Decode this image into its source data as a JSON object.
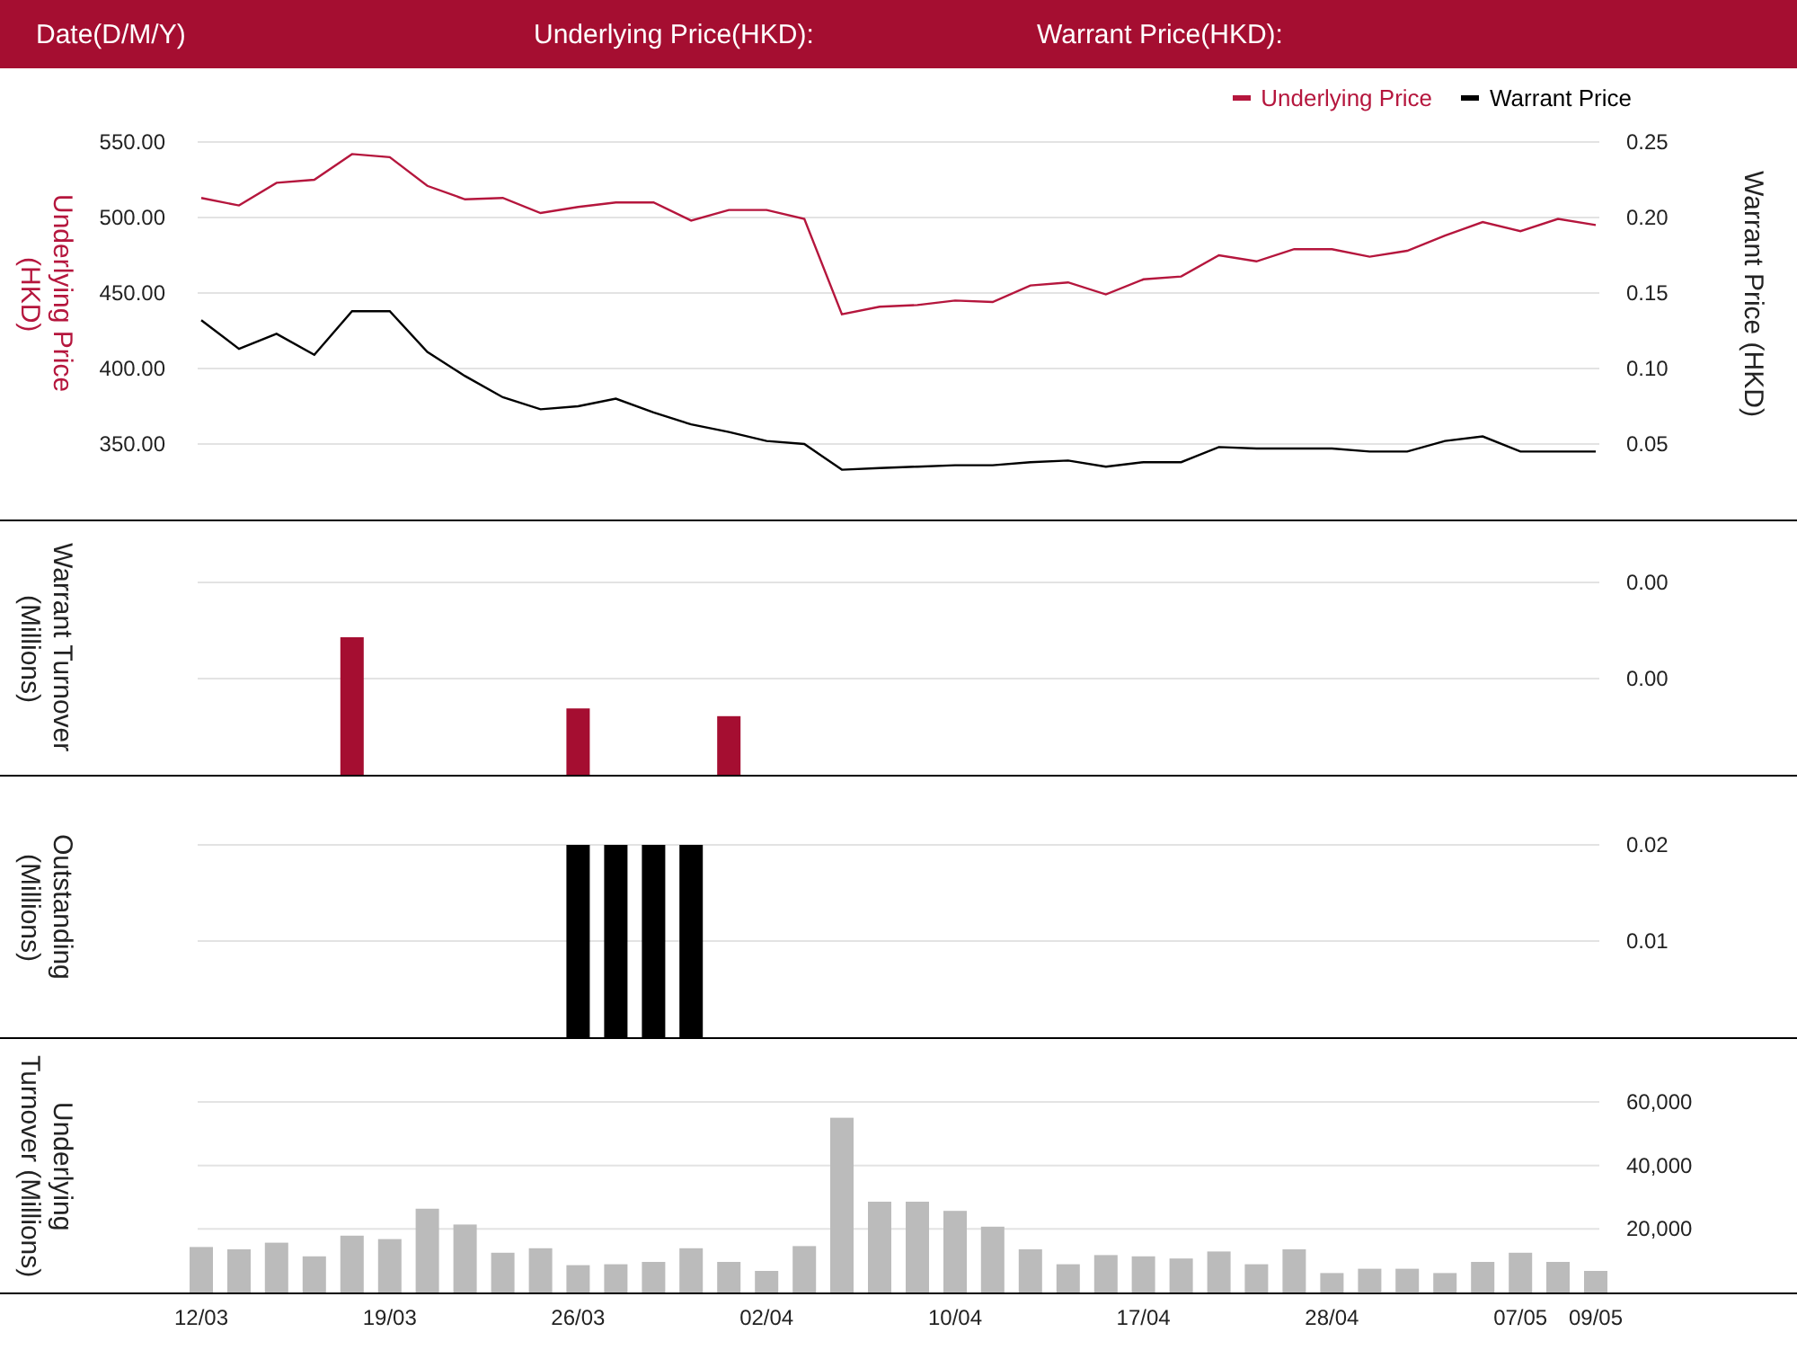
{
  "header": {
    "labels": [
      "Date(D/M/Y)",
      "Underlying Price(HKD):",
      "Warrant Price(HKD):"
    ]
  },
  "panels": [
    {
      "chart_data": {
        "type": "line",
        "ylabel": "Underlying Price (HKD)",
        "grid": true,
        "ylim": [
          300,
          550
        ],
        "yticks": [
          {
            "value": 550,
            "label": "550.00"
          },
          {
            "value": 500,
            "label": "500.00"
          },
          {
            "value": 450,
            "label": "450.00"
          },
          {
            "value": 400,
            "label": "400.00"
          },
          {
            "value": 350,
            "label": "350.00"
          }
        ],
        "series": [
          {
            "name": "Underlying Price",
            "color": "#b5163d",
            "values": [
              513,
              508,
              523,
              525,
              542,
              540,
              521,
              512,
              513,
              503,
              507,
              510,
              510,
              498,
              505,
              505,
              499,
              436,
              441,
              442,
              445,
              444,
              455,
              457,
              449,
              459,
              461,
              475,
              471,
              479,
              479,
              474,
              478,
              488,
              497,
              491,
              499,
              495
            ]
          }
        ]
      },
      "overlay": {
        "chart_data": {
          "type": "line",
          "ylabel": "Warrant Price (HKD)",
          "ylim": [
            0,
            0.25
          ],
          "yticks": [
            {
              "value": 0.25,
              "label": "0.25"
            },
            {
              "value": 0.2,
              "label": "0.20"
            },
            {
              "value": 0.15,
              "label": "0.15"
            },
            {
              "value": 0.1,
              "label": "0.10"
            },
            {
              "value": 0.05,
              "label": "0.05"
            }
          ],
          "series": [
            {
              "name": "Warrant Price",
              "color": "#000000",
              "values": [
                0.132,
                0.113,
                0.123,
                0.109,
                0.138,
                0.138,
                0.111,
                0.095,
                0.081,
                0.073,
                0.075,
                0.08,
                0.071,
                0.063,
                0.058,
                0.052,
                0.05,
                0.033,
                0.034,
                0.035,
                0.036,
                0.036,
                0.038,
                0.039,
                0.035,
                0.038,
                0.038,
                0.048,
                0.047,
                0.047,
                0.047,
                0.045,
                0.045,
                0.052,
                0.055,
                0.045,
                0.045,
                0.045
              ]
            }
          ]
        }
      }
    },
    {
      "chart_data": {
        "type": "bar",
        "ylabel": "Warrant Turnover (Millions)",
        "grid": true,
        "ylim": [
          0,
          0.002
        ],
        "yticks": [
          {
            "value": 0.002,
            "label": "0.00"
          },
          {
            "value": 0.001,
            "label": "0.00"
          }
        ],
        "series": [
          {
            "color": "#a50e31",
            "values": [
              null,
              null,
              null,
              null,
              0.00143,
              null,
              null,
              null,
              null,
              null,
              0.00069,
              null,
              null,
              null,
              0.00061,
              null,
              null,
              null,
              null,
              null,
              null,
              null,
              null,
              null,
              null,
              null,
              null,
              null,
              null,
              null,
              null,
              null,
              null,
              null,
              null,
              null,
              null,
              null
            ]
          }
        ]
      }
    },
    {
      "chart_data": {
        "type": "bar",
        "ylabel": "Outstanding (Millions)",
        "grid": true,
        "ylim": [
          0,
          0.02
        ],
        "yticks": [
          {
            "value": 0.02,
            "label": "0.02"
          },
          {
            "value": 0.01,
            "label": "0.01"
          }
        ],
        "series": [
          {
            "color": "#000000",
            "values": [
              null,
              null,
              null,
              null,
              null,
              null,
              null,
              null,
              null,
              null,
              0.02,
              0.02,
              0.02,
              0.02,
              null,
              null,
              null,
              null,
              null,
              null,
              null,
              null,
              null,
              null,
              null,
              null,
              null,
              null,
              null,
              null,
              null,
              null,
              null,
              null,
              null,
              null,
              null,
              null
            ]
          }
        ]
      }
    },
    {
      "chart_data": {
        "type": "bar",
        "ylabel": "Underlying Turnover (Millions)",
        "grid": true,
        "ylim": [
          0,
          60000
        ],
        "yticks": [
          {
            "value": 60000,
            "label": "60,000"
          },
          {
            "value": 40000,
            "label": "40,000"
          },
          {
            "value": 20000,
            "label": "20,000"
          }
        ],
        "categories": [
          "12/03",
          null,
          null,
          null,
          null,
          "19/03",
          null,
          null,
          null,
          null,
          "26/03",
          null,
          null,
          null,
          null,
          "02/04",
          null,
          null,
          null,
          null,
          "10/04",
          null,
          null,
          null,
          null,
          "17/04",
          null,
          null,
          null,
          null,
          "28/04",
          null,
          null,
          null,
          null,
          "07/05",
          null,
          "09/05"
        ],
        "series": [
          {
            "color": "#bbbbbb",
            "values": [
              14300,
              13600,
              15700,
              11400,
              17900,
              16800,
              26400,
              21400,
              12500,
              13900,
              8600,
              8900,
              9600,
              13900,
              9600,
              6800,
              14600,
              55000,
              28600,
              28600,
              25700,
              20700,
              13600,
              8900,
              11800,
              11400,
              10700,
              12900,
              8900,
              13600,
              6100,
              7500,
              7500,
              6100,
              9600,
              12500,
              9600,
              6800
            ]
          }
        ]
      }
    }
  ]
}
